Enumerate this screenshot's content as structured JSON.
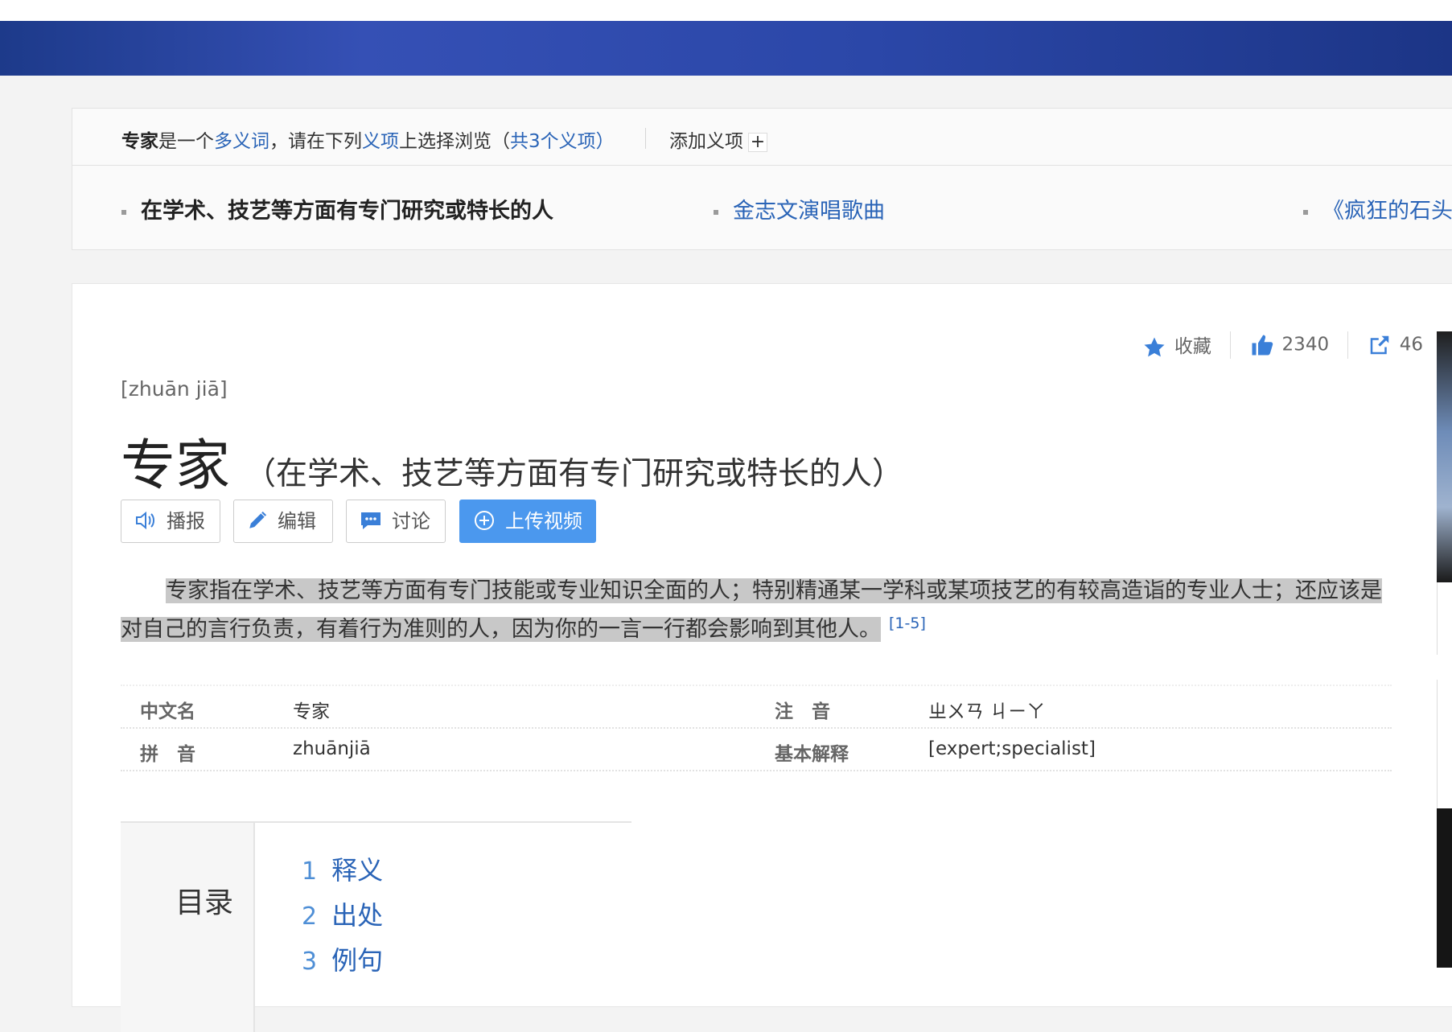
{
  "polysemy": {
    "word": "专家",
    "text1": "是一个",
    "link1": "多义词",
    "text2": "，请在下列",
    "link2": "义项",
    "text3": "上选择浏览（",
    "link3": "共3个义项",
    "text4": "）",
    "add_label": "添加义项",
    "add_symbol": "+"
  },
  "senses": [
    {
      "label": "在学术、技艺等方面有专门研究或特长的人",
      "current": true
    },
    {
      "label": "金志文演唱歌曲",
      "current": false
    },
    {
      "label": "《疯狂的石头",
      "current": false
    }
  ],
  "tools": {
    "collect_label": "收藏",
    "like_count": "2340",
    "share_count": "46"
  },
  "entry": {
    "pinyin": "[zhuān jiā]",
    "title": "专家",
    "subtitle": "（在学术、技艺等方面有专门研究或特长的人）"
  },
  "actions": {
    "play": "播报",
    "edit": "编辑",
    "discuss": "讨论",
    "upload": "上传视频"
  },
  "summary": {
    "text": "专家指在学术、技艺等方面有专门技能或专业知识全面的人；特别精通某一学科或某项技艺的有较高造诣的专业人士；还应该是对自己的言行负责，有着行为准则的人，因为你的一言一行都会影响到其他人。",
    "ref": "[1-5]"
  },
  "basic_info": {
    "rows": [
      {
        "k1": "中文名",
        "v1": "专家",
        "k2": "注　音",
        "v2": "ㄓㄨㄢ ㄐㄧㄚ"
      },
      {
        "k1": "拼　音",
        "v1": "zhuānjiā",
        "k2": "基本解释",
        "v2": "[expert;specialist]"
      }
    ]
  },
  "toc": {
    "title": "目录",
    "items": [
      {
        "num": "1",
        "label": "释义"
      },
      {
        "num": "2",
        "label": "出处"
      },
      {
        "num": "3",
        "label": "例句"
      }
    ]
  },
  "colors": {
    "link": "#2a64b7",
    "banner": "#2b47a8",
    "upload_button": "#4b98ee",
    "highlight": "#c8c8c8"
  }
}
